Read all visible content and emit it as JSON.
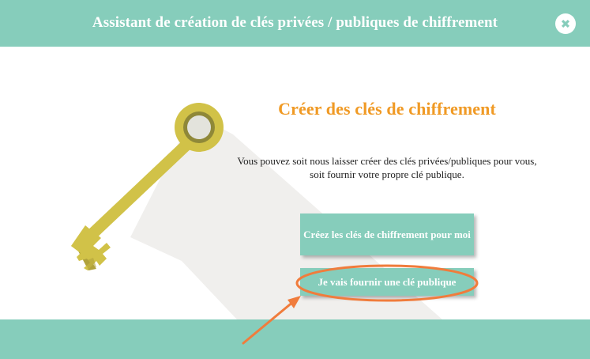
{
  "window": {
    "title": "Assistant de création de clés privées / publiques de chiffrement",
    "close_icon": "close-icon"
  },
  "main": {
    "title": "Créer des clés de chiffrement",
    "description_line1": "Vous pouvez soit nous laisser créer des clés privées/publiques pour vous,",
    "description_line2": "soit fournir votre propre clé publique.",
    "illustration": "key-icon"
  },
  "actions": {
    "create_keys_label": "Créez les clés de chiffrement pour moi",
    "provide_key_label": "Je vais fournir une clé publique"
  },
  "colors": {
    "accent": "#86cdbb",
    "title": "#f09a25",
    "key": "#d1c248",
    "annotation": "#f07c3c"
  }
}
